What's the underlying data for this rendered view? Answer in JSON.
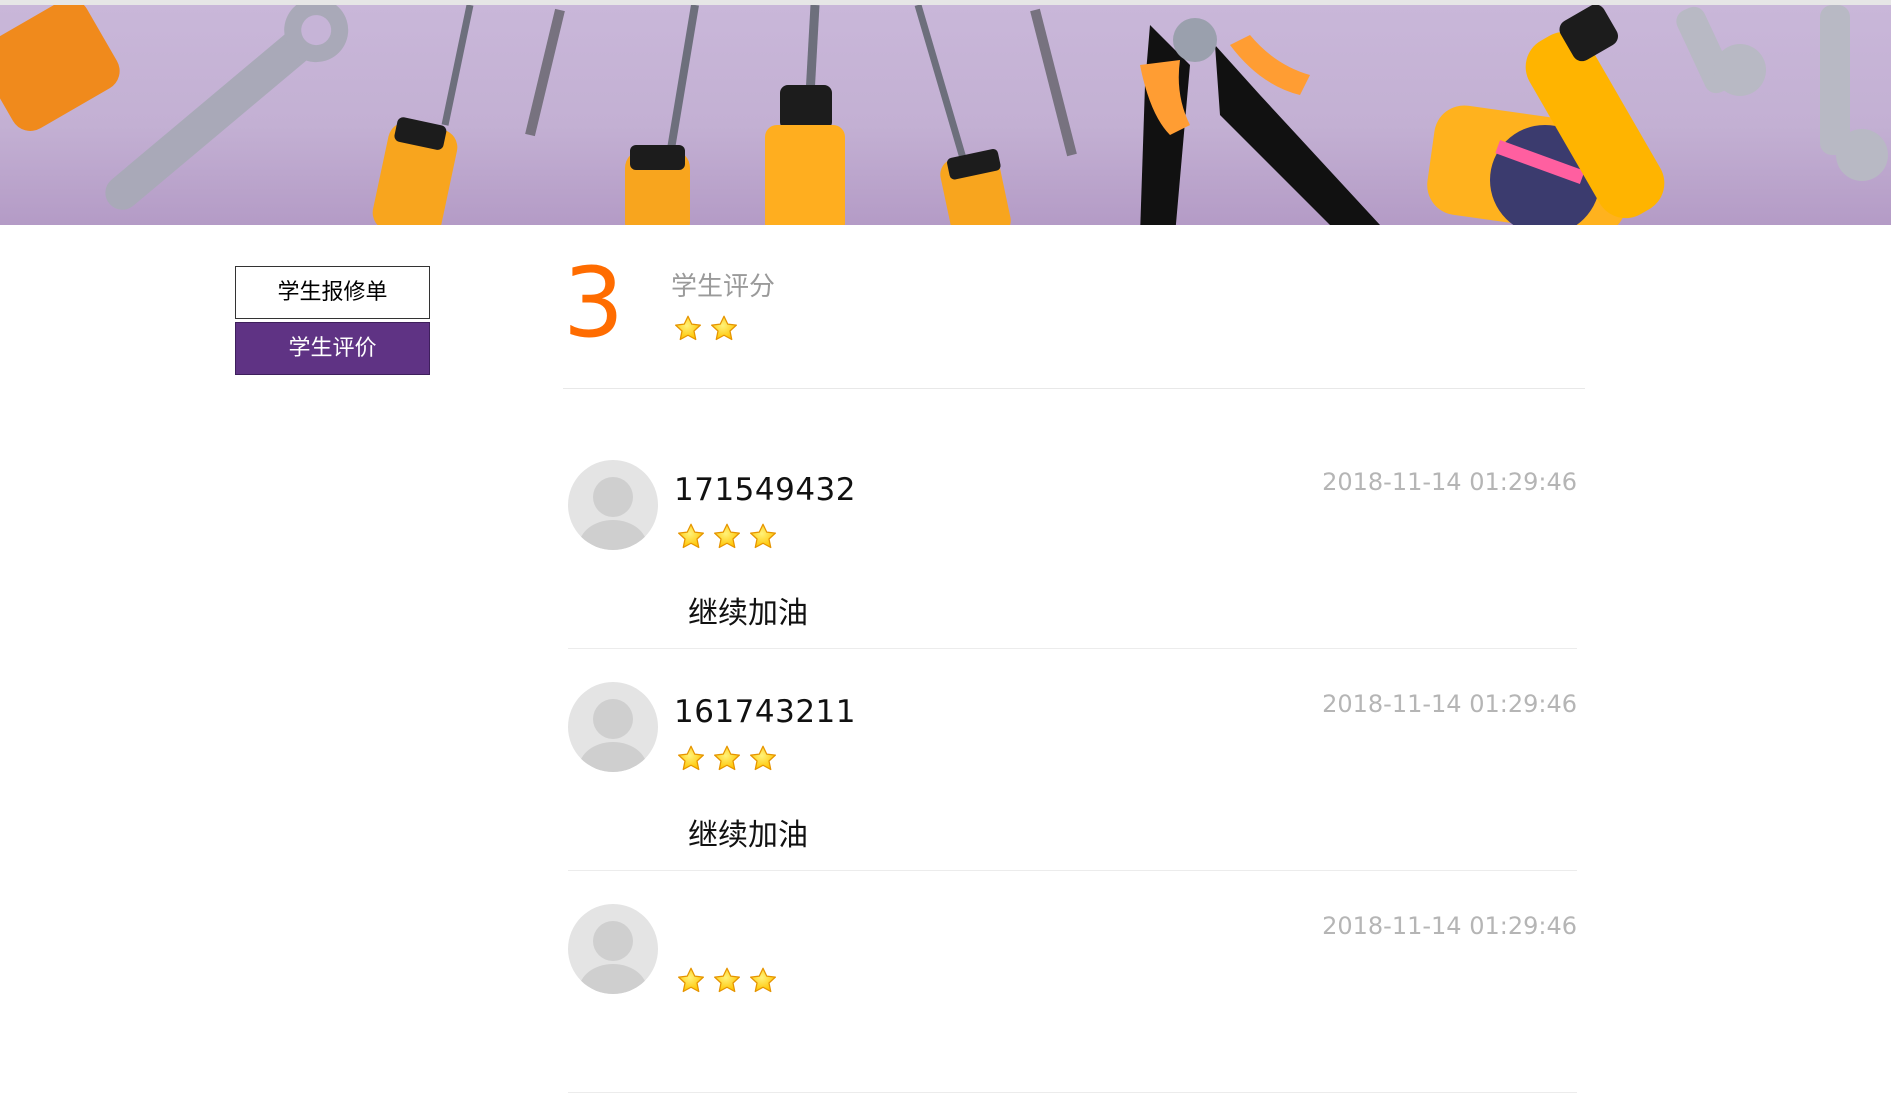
{
  "banner": {
    "icon": "tools-banner-image"
  },
  "sidebar": {
    "items": [
      {
        "label": "学生报修单",
        "active": false
      },
      {
        "label": "学生评价",
        "active": true
      }
    ]
  },
  "summary": {
    "score": "3",
    "title": "学生评分",
    "rating": 2
  },
  "reviews": [
    {
      "id": "171549432",
      "rating": 3,
      "time": "2018-11-14 01:29:46",
      "comment": "继续加油"
    },
    {
      "id": "161743211",
      "rating": 3,
      "time": "2018-11-14 01:29:46",
      "comment": "继续加油"
    },
    {
      "id": "",
      "rating": 3,
      "time": "2018-11-14 01:29:46",
      "comment": ""
    }
  ],
  "colors": {
    "accent": "#5f3384",
    "score": "#ff6c00",
    "star": "#ffc400"
  }
}
